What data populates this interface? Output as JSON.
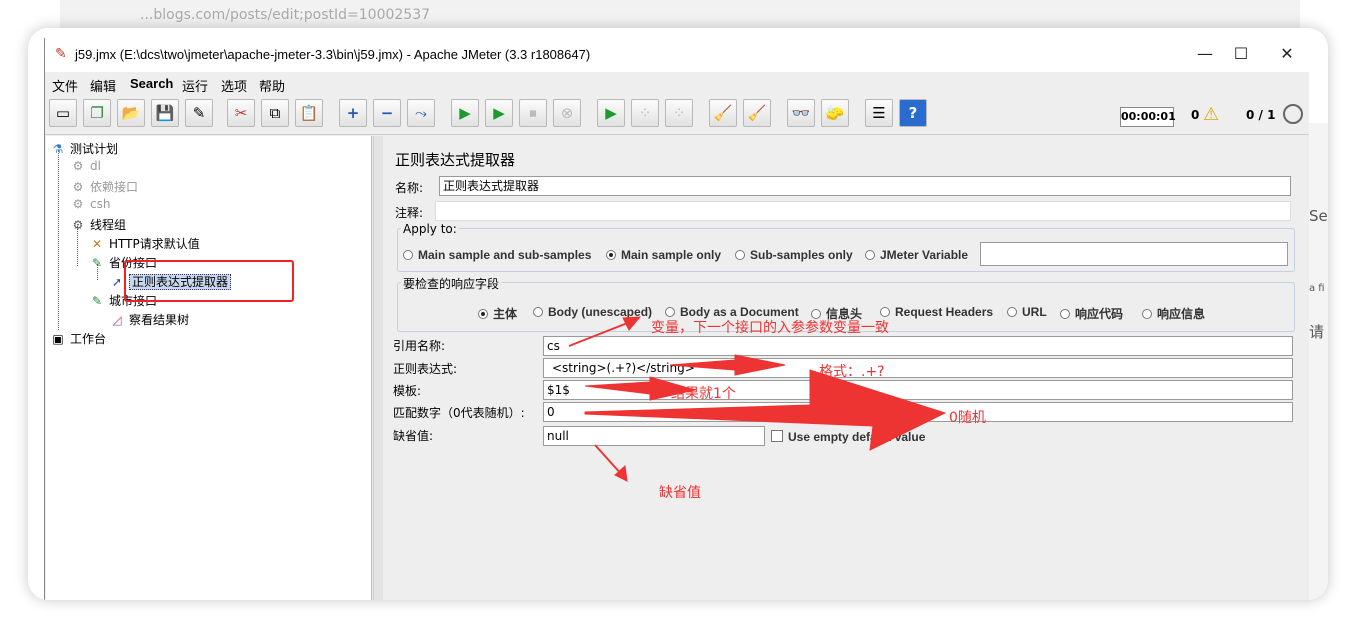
{
  "browser_strip": {
    "text": "...blogs.com/posts/edit;postId=10002537"
  },
  "window": {
    "title": "j59.jmx (E:\\dcs\\two\\jmeter\\apache-jmeter-3.3\\bin\\j59.jmx) - Apache JMeter (3.3 r1808647)",
    "controls": {
      "minimize": "—",
      "maximize": "☐",
      "close": "✕"
    }
  },
  "menu": [
    "文件",
    "编辑",
    "Search",
    "运行",
    "选项",
    "帮助"
  ],
  "toolbar": {
    "timer": "00:00:01",
    "error_count": "0",
    "threads": "0 / 1",
    "buttons": [
      {
        "name": "new-icon",
        "glyph": "▭"
      },
      {
        "name": "templates-icon",
        "glyph": "❐"
      },
      {
        "name": "open-icon",
        "glyph": "📂"
      },
      {
        "name": "save-icon",
        "glyph": "💾"
      },
      {
        "name": "save-as-icon",
        "glyph": "✎"
      },
      {
        "name": "cut-icon",
        "glyph": "✂"
      },
      {
        "name": "copy-icon",
        "glyph": "⧉"
      },
      {
        "name": "paste-icon",
        "glyph": "📋"
      },
      {
        "name": "expand-icon",
        "glyph": "+"
      },
      {
        "name": "collapse-icon",
        "glyph": "−"
      },
      {
        "name": "toggle-icon",
        "glyph": "⤳"
      },
      {
        "name": "start-icon",
        "glyph": "▶"
      },
      {
        "name": "start-no-pause-icon",
        "glyph": "▶"
      },
      {
        "name": "stop-icon",
        "glyph": "⏹"
      },
      {
        "name": "shutdown-icon",
        "glyph": "⊗"
      },
      {
        "name": "remote-start-icon",
        "glyph": "▶"
      },
      {
        "name": "remote-stop-icon",
        "glyph": "⁘"
      },
      {
        "name": "remote-shutdown-icon",
        "glyph": "⁘"
      },
      {
        "name": "clear-icon",
        "glyph": "🧹"
      },
      {
        "name": "clear-all-icon",
        "glyph": "🧹"
      },
      {
        "name": "search-icon",
        "glyph": "👓"
      },
      {
        "name": "reset-search-icon",
        "glyph": "🧽"
      },
      {
        "name": "function-helper-icon",
        "glyph": "☰"
      },
      {
        "name": "help-icon",
        "glyph": "?"
      }
    ]
  },
  "tree": [
    {
      "label": "测试计划",
      "name": "tree-node-test-plan",
      "icon": "flask-icon",
      "state": "normal"
    },
    {
      "label": "dl",
      "name": "tree-node-dl",
      "icon": "gear-icon",
      "state": "disabled"
    },
    {
      "label": "依赖接口",
      "name": "tree-node-dependency",
      "icon": "gear-icon",
      "state": "disabled"
    },
    {
      "label": "csh",
      "name": "tree-node-csh",
      "icon": "gear-icon",
      "state": "disabled"
    },
    {
      "label": "线程组",
      "name": "tree-node-thread-group",
      "icon": "gear-icon",
      "state": "normal"
    },
    {
      "label": "HTTP请求默认值",
      "name": "tree-node-http-defaults",
      "icon": "wrench-icon",
      "state": "normal"
    },
    {
      "label": "省份接口",
      "name": "tree-node-province",
      "icon": "pencil-icon",
      "state": "normal"
    },
    {
      "label": "正则表达式提取器",
      "name": "tree-node-regex-extractor",
      "icon": "arrow-icon",
      "state": "selected"
    },
    {
      "label": "城市接口",
      "name": "tree-node-city",
      "icon": "pencil-icon",
      "state": "normal"
    },
    {
      "label": "察看结果树",
      "name": "tree-node-results-tree",
      "icon": "chart-icon",
      "state": "normal"
    },
    {
      "label": "工作台",
      "name": "tree-node-workbench",
      "icon": "workbench-icon",
      "state": "normal"
    }
  ],
  "panel": {
    "title": "正则表达式提取器",
    "name_label": "名称:",
    "name_value": "正则表达式提取器",
    "comment_label": "注释:",
    "comment_value": "",
    "apply_to": {
      "title": "Apply to:",
      "options": [
        "Main sample and sub-samples",
        "Main sample only",
        "Sub-samples only",
        "JMeter Variable"
      ],
      "selected": "Main sample only",
      "variable_value": ""
    },
    "field_to_check": {
      "title": "要检查的响应字段",
      "options": [
        "主体",
        "Body (unescaped)",
        "Body as a Document",
        "信息头",
        "Request Headers",
        "URL",
        "响应代码",
        "响应信息"
      ],
      "selected": "主体"
    },
    "ref_name_label": "引用名称:",
    "ref_name_value": "cs",
    "regex_label": "正则表达式:",
    "regex_value": "<string>(.+?)</string>",
    "template_label": "模板:",
    "template_value": "$1$",
    "match_no_label": "匹配数字（0代表随机）:",
    "match_no_value": "0",
    "default_label": "缺省值:",
    "default_value": "null",
    "use_empty_label": "Use empty default value"
  },
  "annotations": {
    "ref_note": "变量，下一个接口的入参参数变量一致",
    "regex_note": "格式：.+?",
    "template_note": "结果就1个",
    "match_note": "0随机",
    "default_note": "缺省值",
    "color": "#ee3333"
  },
  "right_peek": [
    "Ser",
    "a fi",
    "请"
  ]
}
